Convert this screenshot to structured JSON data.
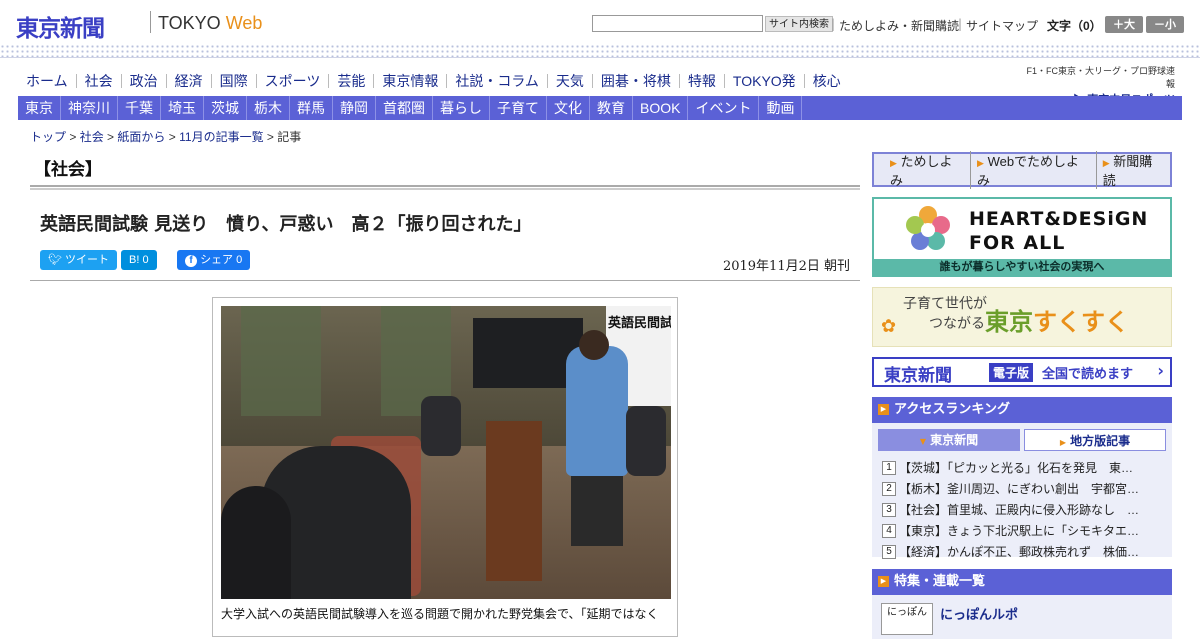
{
  "header": {
    "logo_jp": "東京新聞",
    "logo_en_prefix": "TOKYO ",
    "logo_en_suffix": "Web",
    "search_placeholder": "",
    "search_button": "サイト内検索",
    "links": [
      "ためしよみ・新聞購読",
      "サイトマップ"
    ],
    "font_size_label": "文字（0）",
    "font_bigger": "＋大",
    "font_smaller": "－小"
  },
  "nav_primary": [
    "ホーム",
    "社会",
    "政治",
    "経済",
    "国際",
    "スポーツ",
    "芸能",
    "東京情報",
    "社説・コラム",
    "天気",
    "囲碁・将棋",
    "特報",
    "TOKYO発",
    "核心"
  ],
  "chunichi": {
    "top": "F1・FC東京・大リーグ・プロ野球速報",
    "logo": "▶ 東京中日スポーツ"
  },
  "nav_secondary": [
    "東京",
    "神奈川",
    "千葉",
    "埼玉",
    "茨城",
    "栃木",
    "群馬",
    "静岡",
    "首都圏",
    "暮らし",
    "子育て",
    "文化",
    "教育",
    "BOOK",
    "イベント",
    "動画"
  ],
  "breadcrumb": [
    "トップ",
    "社会",
    "紙面から",
    "11月の記事一覧",
    "記事"
  ],
  "breadcrumb_sep": " > ",
  "article": {
    "category": "【社会】",
    "headline": "英語民間試験 見送り　憤り、戸惑い　高２「振り回された」",
    "share": {
      "tweet": "ツイート",
      "hatena": "B! 0",
      "facebook": "シェア 0"
    },
    "date": "2019年11月2日 朝刊",
    "photo_sign": "英語民間試",
    "caption": "大学入試への英語民間試験導入を巡る問題で開かれた野党集会で、「延期ではなく"
  },
  "sidebar": {
    "links": [
      "ためしよみ",
      "Webでためしよみ",
      "新聞購読"
    ],
    "heart_design": {
      "line1": "HEART&DESiGN",
      "line2": "FOR ALL",
      "sub": "誰もが暮らしやすい社会の実現へ"
    },
    "sukusuku": {
      "small1": "子育て世代が",
      "small2": "つながる",
      "big_pre": "東京",
      "big_main": "すくすく"
    },
    "denshi": {
      "logo": "東京新聞",
      "tag": "電子版",
      "text": "全国で読めます",
      "arrow": "›"
    },
    "ranking": {
      "title": "アクセスランキング",
      "tabs": [
        "東京新聞",
        "地方版記事"
      ],
      "items": [
        {
          "num": "1",
          "text": "【茨城】「ピカッと光る」化石を発見　東…"
        },
        {
          "num": "2",
          "text": "【栃木】釜川周辺、にぎわい創出　宇都宮…"
        },
        {
          "num": "3",
          "text": "【社会】首里城、正殿内に侵入形跡なし　…"
        },
        {
          "num": "4",
          "text": "【東京】きょう下北沢駅上に「シモキタエ…"
        },
        {
          "num": "5",
          "text": "【経済】かんぽ不正、郵政株売れず　株価…"
        }
      ]
    },
    "feature": {
      "title": "特集・連載一覧",
      "item_title": "にっぽんルポ",
      "thumb": "にっぽん"
    }
  },
  "colors": {
    "brand": "#3a3fc4",
    "nav": "#5b61d6",
    "accent": "#e9901a",
    "teal": "#5bb9a8"
  }
}
